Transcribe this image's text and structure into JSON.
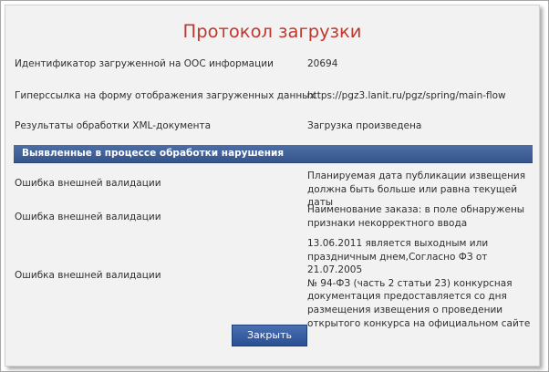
{
  "dialog": {
    "title": "Протокол загрузки",
    "rows": [
      {
        "label": "Идентификатор загруженной на ООС информации",
        "value": "20694"
      },
      {
        "label": "Гиперссылка на форму отображения загруженных данных",
        "value": "https://pgz3.lanit.ru/pgz/spring/main-flow"
      },
      {
        "label": "Результаты обработки XML-документа",
        "value": "Загрузка произведена"
      }
    ],
    "section_title": "Выявленные в процессе обработки нарушения",
    "errors": [
      {
        "label": "Ошибка внешней валидации",
        "message": "Планируемая дата публикации извещения\nдолжна быть больше или равна текущей даты"
      },
      {
        "label": "Ошибка внешней валидации",
        "message": "Наименование заказа: в поле обнаружены\nпризнаки некорректного ввода"
      },
      {
        "label": "Ошибка внешней валидации",
        "message": "13.06.2011 является выходным или\nпраздничным днем,Согласно ФЗ от 21.07.2005\n№ 94-ФЗ (часть 2 статьи 23) конкурсная\nдокументация предоставляется со дня\nразмещения извещения о проведении\nоткрытого конкурса на официальном сайте"
      }
    ],
    "close_label": "Закрыть"
  }
}
